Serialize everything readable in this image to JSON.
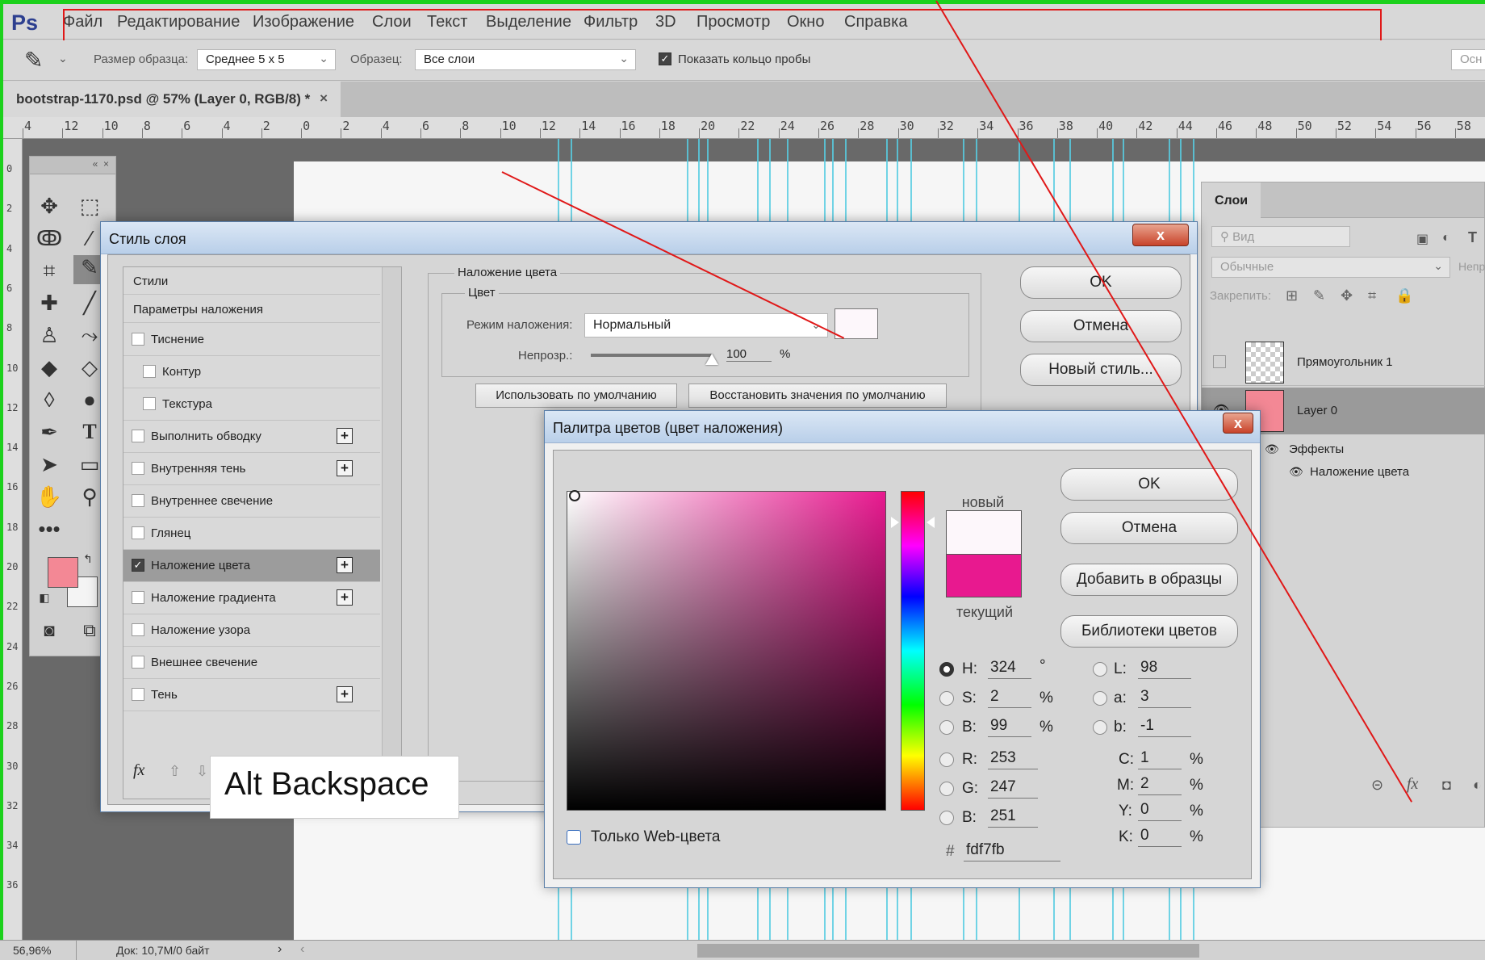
{
  "app": {
    "logo": "Ps"
  },
  "menu": [
    "Файл",
    "Редактирование",
    "Изображение",
    "Слои",
    "Текст",
    "Выделение",
    "Фильтр",
    "3D",
    "Просмотр",
    "Окно",
    "Справка"
  ],
  "options": {
    "sample_size_label": "Размер образца:",
    "sample_size_value": "Среднее 5 х 5",
    "sample_label": "Образец:",
    "sample_value": "Все слои",
    "show_ring_label": "Показать кольцо пробы",
    "right_cut": "Осн"
  },
  "document_tab": {
    "title": "bootstrap-1170.psd @ 57% (Layer 0, RGB/8) *",
    "close": "×"
  },
  "ruler": {
    "h_ticks": [
      "4",
      "12",
      "10",
      "8",
      "6",
      "4",
      "2",
      "0",
      "2",
      "4",
      "6",
      "8",
      "10",
      "12",
      "14",
      "16",
      "18",
      "20",
      "22",
      "24",
      "26",
      "28",
      "30",
      "32",
      "34",
      "36",
      "38",
      "40",
      "42",
      "44",
      "46",
      "48",
      "50",
      "52",
      "54",
      "56",
      "58"
    ],
    "v_ticks": [
      "0",
      "2",
      "4",
      "6",
      "8",
      "10",
      "12",
      "14",
      "16",
      "18",
      "20",
      "22",
      "24",
      "26",
      "28",
      "30",
      "32",
      "34",
      "36"
    ]
  },
  "layer_style": {
    "title": "Стиль слоя",
    "close": "x",
    "styles_header": "Стили",
    "blend_params": "Параметры наложения",
    "items": [
      {
        "label": "Тиснение",
        "checked": false,
        "plus": false,
        "indent": 0
      },
      {
        "label": "Контур",
        "checked": false,
        "plus": false,
        "indent": 1
      },
      {
        "label": "Текстура",
        "checked": false,
        "plus": false,
        "indent": 1
      },
      {
        "label": "Выполнить обводку",
        "checked": false,
        "plus": true,
        "indent": 0
      },
      {
        "label": "Внутренняя тень",
        "checked": false,
        "plus": true,
        "indent": 0
      },
      {
        "label": "Внутреннее свечение",
        "checked": false,
        "plus": false,
        "indent": 0
      },
      {
        "label": "Глянец",
        "checked": false,
        "plus": false,
        "indent": 0
      },
      {
        "label": "Наложение цвета",
        "checked": true,
        "plus": true,
        "indent": 0,
        "selected": true
      },
      {
        "label": "Наложение градиента",
        "checked": false,
        "plus": true,
        "indent": 0
      },
      {
        "label": "Наложение узора",
        "checked": false,
        "plus": false,
        "indent": 0
      },
      {
        "label": "Внешнее свечение",
        "checked": false,
        "plus": false,
        "indent": 0
      },
      {
        "label": "Тень",
        "checked": false,
        "plus": true,
        "indent": 0
      }
    ],
    "fx": "fx",
    "section_title": "Наложение цвета",
    "color_group": "Цвет",
    "blend_mode_label": "Режим наложения:",
    "blend_mode_value": "Нормальный",
    "opacity_label": "Непрозр.:",
    "opacity_value": "100",
    "opacity_unit": "%",
    "opacity_level": 1.0,
    "btn_default": "Использовать по умолчанию",
    "btn_restore": "Восстановить значения по умолчанию",
    "ok": "OK",
    "cancel": "Отмена",
    "new_style": "Новый стиль..."
  },
  "color_picker": {
    "title": "Палитра цветов (цвет наложения)",
    "close": "x",
    "new_label": "новый",
    "current_label": "текущий",
    "new_color": "#fdf7fb",
    "current_color": "#e8198f",
    "ok": "OK",
    "cancel": "Отмена",
    "add_swatches": "Добавить в образцы",
    "libraries": "Библиотеки цветов",
    "H": {
      "label": "H:",
      "value": "324",
      "unit": "°"
    },
    "S": {
      "label": "S:",
      "value": "2",
      "unit": "%"
    },
    "Bv": {
      "label": "B:",
      "value": "99",
      "unit": "%"
    },
    "R": {
      "label": "R:",
      "value": "253"
    },
    "G": {
      "label": "G:",
      "value": "247"
    },
    "Bb": {
      "label": "B:",
      "value": "251"
    },
    "L": {
      "label": "L:",
      "value": "98"
    },
    "a": {
      "label": "a:",
      "value": "3"
    },
    "b": {
      "label": "b:",
      "value": "-1"
    },
    "C": {
      "label": "C:",
      "value": "1",
      "unit": "%"
    },
    "M": {
      "label": "M:",
      "value": "2",
      "unit": "%"
    },
    "Y": {
      "label": "Y:",
      "value": "0",
      "unit": "%"
    },
    "K": {
      "label": "K:",
      "value": "0",
      "unit": "%"
    },
    "hex_label": "#",
    "hex": "fdf7fb",
    "web_only": "Только Web-цвета"
  },
  "layers_panel": {
    "tab": "Слои",
    "search": "Вид",
    "mode": "Обычные",
    "opacity_cut": "Непро",
    "lock_label": "Закрепить:",
    "layers": [
      "Прямоугольник 1",
      "Layer 0"
    ],
    "effects": "Эффекты",
    "effect_item": "Наложение цвета"
  },
  "status": {
    "zoom": "56,96%",
    "doc": "Док: 10,7M/0 байт"
  },
  "overlay_caption": "Alt Backspace",
  "colors": {
    "accent_pink": "#e8198f",
    "foreground": "#f38895",
    "guide": "#58cde2",
    "annotation": "#e01818"
  }
}
